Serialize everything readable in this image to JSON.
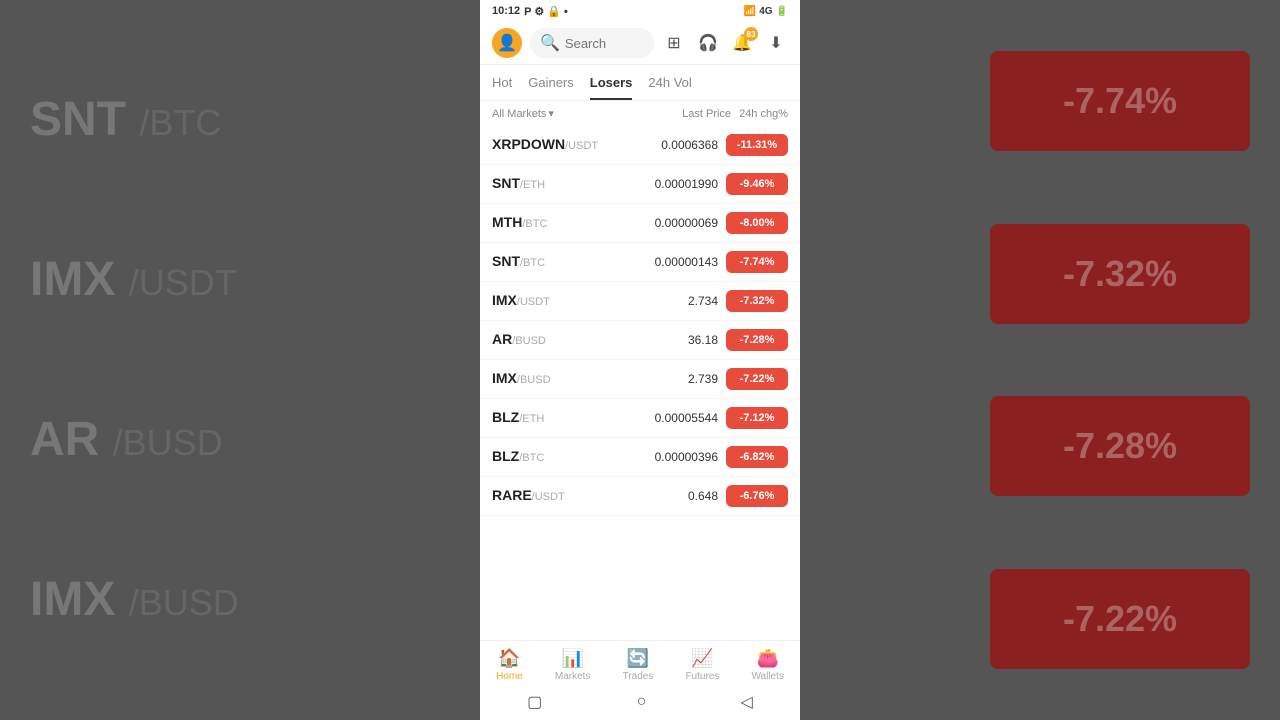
{
  "statusBar": {
    "time": "10:12",
    "indicators": "P ⚙ 🔒 •",
    "signal": "📶",
    "battery": "🔋"
  },
  "search": {
    "placeholder": "Search"
  },
  "notificationCount": "83",
  "tabs": [
    {
      "id": "hot",
      "label": "Hot",
      "active": false
    },
    {
      "id": "gainers",
      "label": "Gainers",
      "active": false
    },
    {
      "id": "losers",
      "label": "Losers",
      "active": true
    },
    {
      "id": "24vol",
      "label": "24h Vol",
      "active": false
    }
  ],
  "filter": {
    "label": "All Markets",
    "col1": "Last Price",
    "col2": "24h chg%"
  },
  "markets": [
    {
      "symbol": "XRPDOWN",
      "pair": "/USDT",
      "price": "0.0006368",
      "change": "-11.31%"
    },
    {
      "symbol": "SNT",
      "pair": "/ETH",
      "price": "0.00001990",
      "change": "-9.46%"
    },
    {
      "symbol": "MTH",
      "pair": "/BTC",
      "price": "0.00000069",
      "change": "-8.00%"
    },
    {
      "symbol": "SNT",
      "pair": "/BTC",
      "price": "0.00000143",
      "change": "-7.74%"
    },
    {
      "symbol": "IMX",
      "pair": "/USDT",
      "price": "2.734",
      "change": "-7.32%"
    },
    {
      "symbol": "AR",
      "pair": "/BUSD",
      "price": "36.18",
      "change": "-7.28%"
    },
    {
      "symbol": "IMX",
      "pair": "/BUSD",
      "price": "2.739",
      "change": "-7.22%"
    },
    {
      "symbol": "BLZ",
      "pair": "/ETH",
      "price": "0.00005544",
      "change": "-7.12%"
    },
    {
      "symbol": "BLZ",
      "pair": "/BTC",
      "price": "0.00000396",
      "change": "-6.82%"
    },
    {
      "symbol": "RARE",
      "pair": "/USDT",
      "price": "0.648",
      "change": "-6.76%"
    }
  ],
  "bottomNav": [
    {
      "id": "home",
      "label": "Home",
      "active": true,
      "icon": "🏠"
    },
    {
      "id": "markets",
      "label": "Markets",
      "active": false,
      "icon": "📊"
    },
    {
      "id": "trades",
      "label": "Trades",
      "active": false,
      "icon": "🔄"
    },
    {
      "id": "futures",
      "label": "Futures",
      "active": false,
      "icon": "📈"
    },
    {
      "id": "wallets",
      "label": "Wallets",
      "active": false,
      "icon": "👛"
    }
  ],
  "bgTexts": [
    {
      "symbol": "SNT",
      "pair": "/BTC"
    },
    {
      "symbol": "IMX",
      "pair": "/USDT"
    },
    {
      "symbol": "AR",
      "pair": "/BUSD"
    },
    {
      "symbol": "IMX",
      "pair": "/BUSD"
    }
  ],
  "bgBadges": [
    "-7.74%",
    "-7.32%",
    "-7.28%",
    "-7.22%"
  ]
}
